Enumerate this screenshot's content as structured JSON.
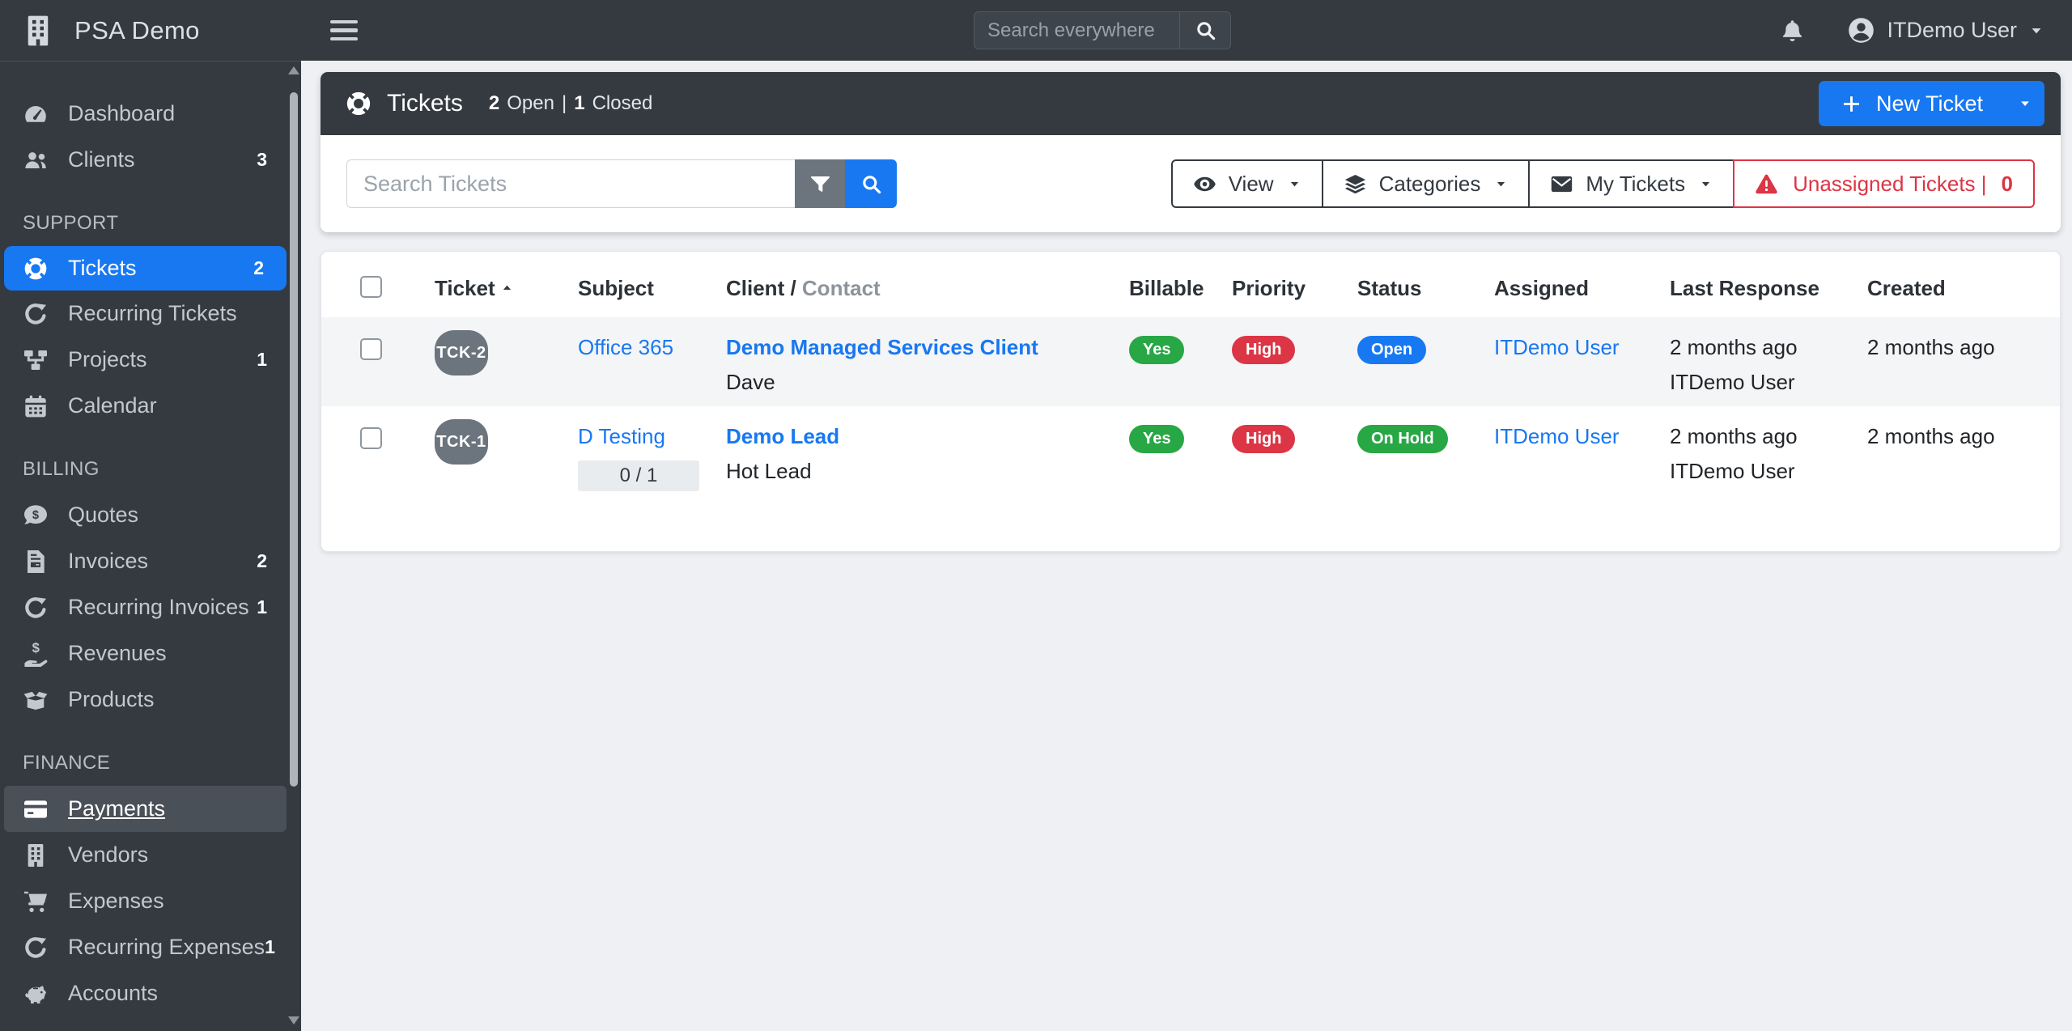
{
  "navbar": {
    "brand": "PSA Demo",
    "search_placeholder": "Search everywhere",
    "user_name": "ITDemo User"
  },
  "sidebar": {
    "sections": [
      {
        "header": "",
        "items": [
          {
            "label": "Dashboard",
            "icon": "gauge-icon",
            "badge": ""
          },
          {
            "label": "Clients",
            "icon": "users-icon",
            "badge": "3"
          }
        ]
      },
      {
        "header": "SUPPORT",
        "items": [
          {
            "label": "Tickets",
            "icon": "life-ring-icon",
            "badge": "2",
            "state": "active"
          },
          {
            "label": "Recurring Tickets",
            "icon": "refresh-icon",
            "badge": ""
          },
          {
            "label": "Projects",
            "icon": "project-diagram-icon",
            "badge": "1"
          },
          {
            "label": "Calendar",
            "icon": "calendar-icon",
            "badge": ""
          }
        ]
      },
      {
        "header": "BILLING",
        "items": [
          {
            "label": "Quotes",
            "icon": "comment-dollar-icon",
            "badge": ""
          },
          {
            "label": "Invoices",
            "icon": "file-invoice-icon",
            "badge": "2"
          },
          {
            "label": "Recurring Invoices",
            "icon": "refresh-icon",
            "badge": "1"
          },
          {
            "label": "Revenues",
            "icon": "hand-holding-dollar-icon",
            "badge": ""
          },
          {
            "label": "Products",
            "icon": "box-open-icon",
            "badge": ""
          }
        ]
      },
      {
        "header": "FINANCE",
        "items": [
          {
            "label": "Payments",
            "icon": "credit-card-icon",
            "badge": "",
            "state": "hover"
          },
          {
            "label": "Vendors",
            "icon": "building-icon",
            "badge": ""
          },
          {
            "label": "Expenses",
            "icon": "shopping-cart-icon",
            "badge": ""
          },
          {
            "label": "Recurring Expenses",
            "icon": "refresh-icon",
            "badge": "1"
          },
          {
            "label": "Accounts",
            "icon": "piggy-bank-icon",
            "badge": ""
          }
        ]
      }
    ]
  },
  "page": {
    "title": "Tickets",
    "open_count": "2",
    "open_label": "Open",
    "separator": "|",
    "closed_count": "1",
    "closed_label": "Closed",
    "new_ticket_label": "New Ticket"
  },
  "toolbar": {
    "search_placeholder": "Search Tickets",
    "view_label": "View",
    "categories_label": "Categories",
    "my_tickets_label": "My Tickets",
    "unassigned_label": "Unassigned Tickets |",
    "unassigned_count": "0"
  },
  "table": {
    "headers": {
      "ticket": "Ticket",
      "subject": "Subject",
      "client": "Client /",
      "contact": "Contact",
      "billable": "Billable",
      "priority": "Priority",
      "status": "Status",
      "assigned": "Assigned",
      "last_response": "Last Response",
      "created": "Created"
    },
    "rows": [
      {
        "ticket_id": "TCK-2",
        "subject": "Office 365",
        "progress": "",
        "client": "Demo Managed Services Client",
        "contact": "Dave",
        "billable": "Yes",
        "billable_color": "#28a745",
        "priority": "High",
        "priority_color": "#dc3545",
        "status": "Open",
        "status_color": "#1778F2",
        "assigned": "ITDemo User",
        "last_response_time": "2 months ago",
        "last_response_by": "ITDemo User",
        "created": "2 months ago"
      },
      {
        "ticket_id": "TCK-1",
        "subject": "D Testing",
        "progress": "0 / 1",
        "client": "Demo Lead",
        "contact": "Hot Lead",
        "billable": "Yes",
        "billable_color": "#28a745",
        "priority": "High",
        "priority_color": "#dc3545",
        "status": "On Hold",
        "status_color": "#28a745",
        "assigned": "ITDemo User",
        "last_response_time": "2 months ago",
        "last_response_by": "ITDemo User",
        "created": "2 months ago"
      }
    ]
  },
  "colors": {
    "primary": "#1778F2",
    "success": "#28a745",
    "danger": "#dc3545",
    "secondary": "#6c757d",
    "dark": "#343a40",
    "main_background": "#eef0f4"
  }
}
